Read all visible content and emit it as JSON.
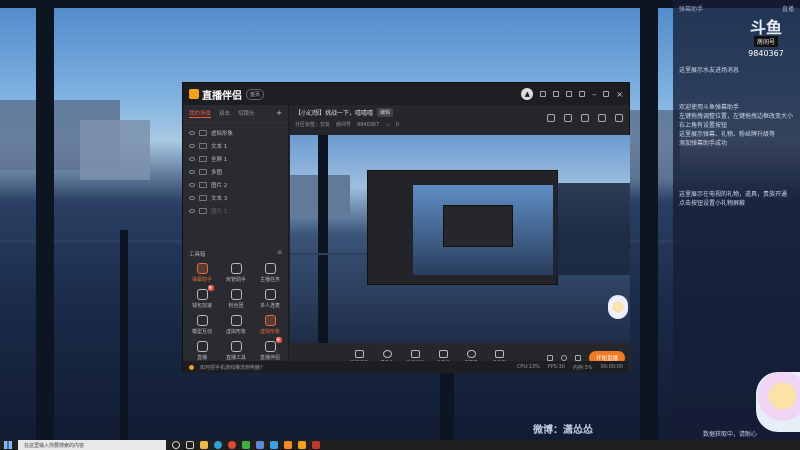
{
  "desktop": {
    "chat_panel": {
      "top_left": "弹幕助手",
      "top_right": "直播",
      "logo_text": "斗鱼",
      "logo_sub": "房间号",
      "room_id": "9840367",
      "messages": [
        "这里展示水友进场消息",
        "欢迎使用斗鱼弹幕助手",
        "左键拖拽调整位置，左键拖拽边框改变大小",
        "右上角有设置按钮",
        "这里展示弹幕、礼物、粉丝牌升级等",
        "添加弹幕助手成功",
        "这里展示在电视的礼物，道具，贵族开通",
        "点击按钮设置小礼物屏蔽"
      ],
      "bottom": "数据获取中，请耐心"
    },
    "watermark": "微博：潇怂怂"
  },
  "app": {
    "name": "直播伴侣",
    "badge": "首页",
    "scene_tabs": [
      "我的场景",
      "双击",
      "切镜头"
    ],
    "sources": [
      {
        "label": "虚拟形象",
        "dim": false
      },
      {
        "label": "文本 1",
        "dim": false
      },
      {
        "label": "全屏 1",
        "dim": false
      },
      {
        "label": "多图",
        "dim": false
      },
      {
        "label": "图片 2",
        "dim": false
      },
      {
        "label": "文本 3",
        "dim": false
      },
      {
        "label": "图片 1",
        "dim": true
      }
    ],
    "toolbox_title": "工具箱",
    "tools": [
      {
        "label": "弹幕助手",
        "orange": true,
        "tag": ""
      },
      {
        "label": "房管助手",
        "orange": false,
        "tag": ""
      },
      {
        "label": "主播任务",
        "orange": false,
        "tag": ""
      },
      {
        "label": "钱包加速",
        "orange": false,
        "tag": "新"
      },
      {
        "label": "粉丝团",
        "orange": false,
        "tag": ""
      },
      {
        "label": "多人连麦",
        "orange": false,
        "tag": ""
      },
      {
        "label": "模型互动",
        "orange": false,
        "tag": ""
      },
      {
        "label": "虚拟形象",
        "orange": false,
        "tag": ""
      },
      {
        "label": "虚拟形象",
        "orange": true,
        "tag": ""
      },
      {
        "label": "直播",
        "orange": false,
        "tag": ""
      },
      {
        "label": "直播工具",
        "orange": false,
        "tag": ""
      },
      {
        "label": "直播伴侣",
        "orange": false,
        "tag": "新"
      }
    ],
    "live_title": "【小幻想】挑战一下，嘻嘻嘻",
    "edit_chip": "编辑",
    "live_sub_left": "分区标签：交友",
    "live_sub_mid": "房间号",
    "live_sub_id": "9840367",
    "live_sub_count": "0",
    "controls": [
      {
        "label": "弹幕屏幕"
      },
      {
        "label": "摄像头"
      },
      {
        "label": "手机投屏"
      },
      {
        "label": "录播机"
      },
      {
        "label": "麦克风"
      },
      {
        "label": "扬声器"
      }
    ],
    "start_button": "开始直播",
    "status_hint": "如何把手机游戏推流到电脑?",
    "status_cpu": "CPU:13%",
    "status_fps": "FPS:30",
    "status_mem": "内存:5%",
    "status_time": "00:00:00"
  },
  "taskbar": {
    "search_placeholder": "在这里输入你要搜索的内容"
  }
}
